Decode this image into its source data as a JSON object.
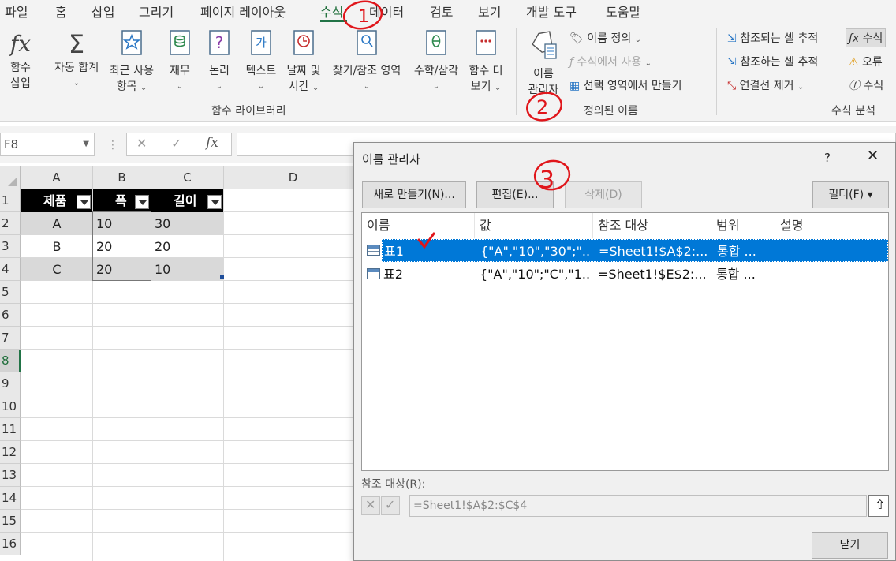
{
  "menu": {
    "tabs": [
      "파일",
      "홈",
      "삽입",
      "그리기",
      "페이지 레이아웃",
      "수식",
      "데이터",
      "검토",
      "보기",
      "개발 도구",
      "도움말"
    ],
    "active": "수식"
  },
  "ribbon": {
    "function_library": {
      "insert_function": [
        "함수",
        "삽입"
      ],
      "autosum": "자동 합계",
      "recent": [
        "최근 사용",
        "항목"
      ],
      "financial": "재무",
      "logical": "논리",
      "text": "텍스트",
      "datetime": [
        "날짜 및",
        "시간"
      ],
      "lookup": "찾기/참조 영역",
      "math": "수학/삼각",
      "more": [
        "함수 더",
        "보기"
      ],
      "label": "함수 라이브러리",
      "icon_fx": "fx",
      "icon_text": "가"
    },
    "defined_names": {
      "name_manager": [
        "이름",
        "관리자"
      ],
      "define_name": "이름 정의",
      "use_in_formula": "수식에서 사용",
      "create_from_selection": "선택 영역에서 만들기",
      "label": "정의된 이름"
    },
    "formula_auditing": {
      "trace_precedents": "참조되는 셀 추적",
      "trace_dependents": "참조하는 셀 추적",
      "remove_arrows": "연결선 제거",
      "show_formulas": "수식",
      "error_checking": "오류",
      "evaluate": "수식",
      "label": "수식 분석"
    }
  },
  "formula_bar": {
    "name_box": "F8",
    "cancel": "✕",
    "enter": "✓",
    "fx": "fx",
    "value": ""
  },
  "sheet": {
    "columns": [
      "A",
      "B",
      "C",
      "D"
    ],
    "rows": [
      "1",
      "2",
      "3",
      "4",
      "5",
      "6",
      "7",
      "8",
      "9",
      "10",
      "11",
      "12",
      "13",
      "14",
      "15",
      "16"
    ],
    "selected_row": "8",
    "table": {
      "headers": [
        "제품",
        "폭",
        "길이"
      ],
      "data": [
        [
          "A",
          "10",
          "30"
        ],
        [
          "B",
          "20",
          "20"
        ],
        [
          "C",
          "20",
          "10"
        ]
      ]
    }
  },
  "dialog": {
    "title": "이름 관리자",
    "help": "?",
    "close": "✕",
    "buttons": {
      "new": "새로 만들기(N)...",
      "edit": "편집(E)...",
      "delete": "삭제(D)",
      "filter": "필터(F) ▾",
      "close": "닫기"
    },
    "list_headers": [
      "이름",
      "값",
      "참조 대상",
      "범위",
      "설명"
    ],
    "rows": [
      {
        "name": "표1",
        "value": "{\"A\",\"10\",\"30\";\"...",
        "refers_to": "=Sheet1!$A$2:...",
        "scope": "통합 ...",
        "comment": ""
      },
      {
        "name": "표2",
        "value": "{\"A\",\"10\";\"C\",\"1...",
        "refers_to": "=Sheet1!$E$2:...",
        "scope": "통합 ...",
        "comment": ""
      }
    ],
    "selected_row": 0,
    "refers_to_label": "참조 대상(R):",
    "refers_to_value": "=Sheet1!$A$2:$C$4"
  },
  "annotations": {
    "step1": "1",
    "step2": "2",
    "step3": "3",
    "color": "#e0161b"
  },
  "colors": {
    "accent": "#217346",
    "selection": "#0078d7"
  }
}
